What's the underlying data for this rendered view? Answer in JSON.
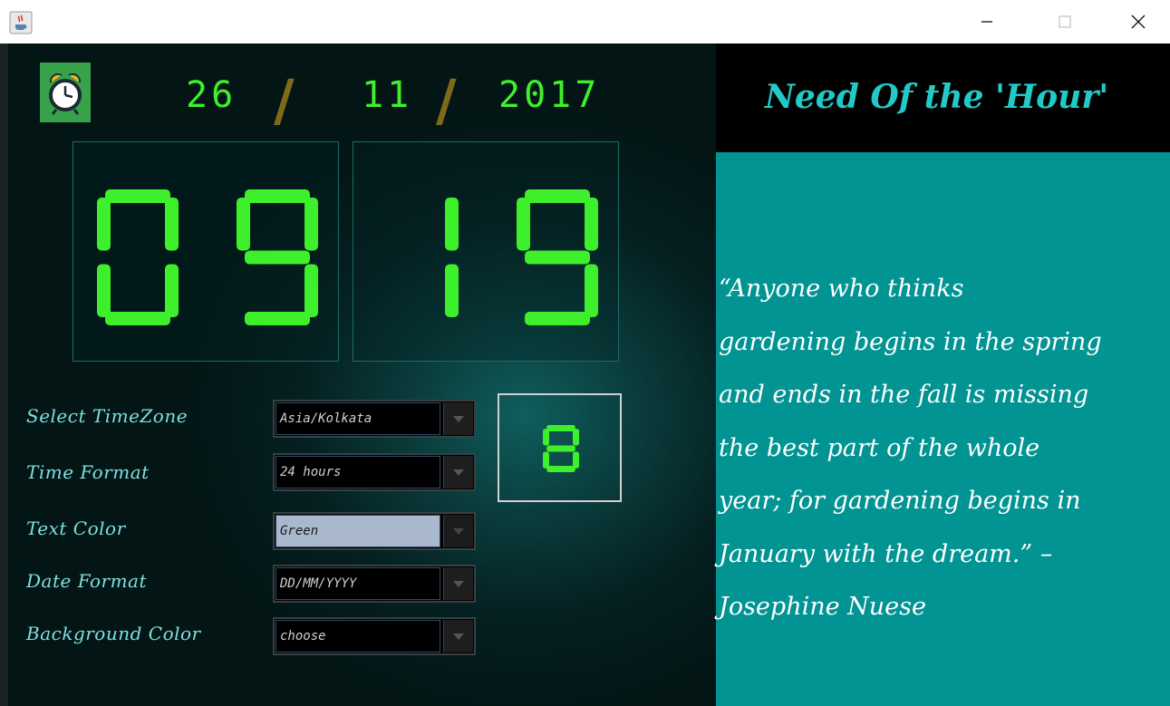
{
  "window": {
    "icons": {
      "app": "java-cup-icon",
      "minimize": "minimize-icon",
      "maximize": "maximize-icon",
      "close": "close-icon"
    }
  },
  "clock": {
    "alarm_icon": "alarm-clock-icon",
    "date": {
      "day": "26",
      "month": "11",
      "year": "2017",
      "separator": "/"
    },
    "time": {
      "hours": "09",
      "minutes": "19"
    },
    "preview_digit": "8",
    "text_color": "#3ef02c"
  },
  "settings": {
    "timezone": {
      "label": "Select TimeZone",
      "value": "Asia/Kolkata"
    },
    "time_format": {
      "label": "Time Format",
      "value": "24 hours"
    },
    "text_color": {
      "label": "Text Color",
      "value": "Green"
    },
    "date_format": {
      "label": "Date Format",
      "value": "DD/MM/YYYY"
    },
    "background_color": {
      "label": "Background Color",
      "value": "choose"
    }
  },
  "quote_panel": {
    "title": "Need Of the 'Hour'",
    "lines": [
      "“Anyone who thinks",
      "gardening begins in the spring",
      "and ends in the fall is missing",
      "the best part of the whole",
      "year; for gardening begins in",
      "January with the dream.” –",
      "Josephine Nuese"
    ]
  },
  "colors": {
    "accent_teal": "#029393",
    "title_teal": "#22c9c6",
    "digit_green": "#3ef02c",
    "separator_olive": "#7e6a1a"
  }
}
